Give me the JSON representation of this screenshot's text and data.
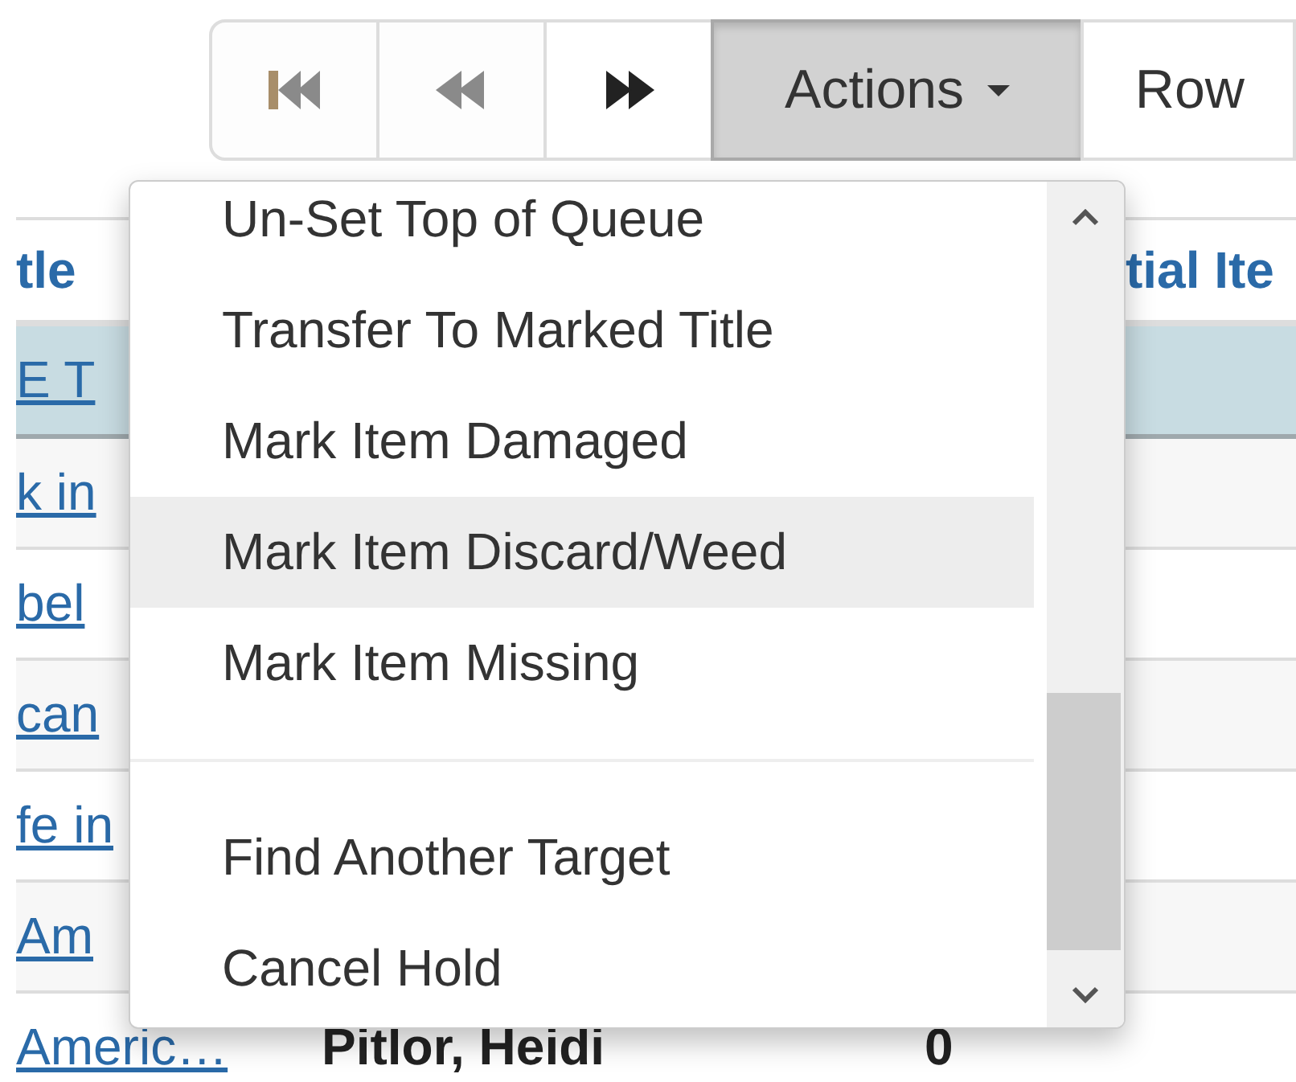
{
  "toolbar": {
    "nav_buttons": [
      {
        "kind": "first",
        "disabled": true
      },
      {
        "kind": "previous",
        "disabled": true
      },
      {
        "kind": "next",
        "disabled": false
      }
    ],
    "actions_button": {
      "label": "Actions",
      "expanded": true
    },
    "rows_button": {
      "label": "Row"
    }
  },
  "table": {
    "columns": [
      {
        "label": "tle"
      },
      {
        "label": "tial Ite"
      }
    ],
    "rows": [
      {
        "title": "E T",
        "selected": true
      },
      {
        "title": "k in",
        "selected": false
      },
      {
        "title": "bel",
        "selected": false
      },
      {
        "title": "can",
        "selected": false
      },
      {
        "title": "fe in",
        "selected": false
      },
      {
        "title": "Am",
        "selected": false
      },
      {
        "title": "Americ…",
        "author": "Pitlor, Heidi",
        "count": "0",
        "selected": false
      }
    ]
  },
  "actions_menu": {
    "groups": [
      [
        {
          "label": "Un-Set Top of Queue",
          "hovered": false
        },
        {
          "label": "Transfer To Marked Title",
          "hovered": false
        },
        {
          "label": "Mark Item Damaged",
          "hovered": false
        },
        {
          "label": "Mark Item Discard/Weed",
          "hovered": true
        },
        {
          "label": "Mark Item Missing",
          "hovered": false
        }
      ],
      [
        {
          "label": "Find Another Target",
          "hovered": false
        },
        {
          "label": "Cancel Hold",
          "hovered": false
        }
      ]
    ]
  }
}
